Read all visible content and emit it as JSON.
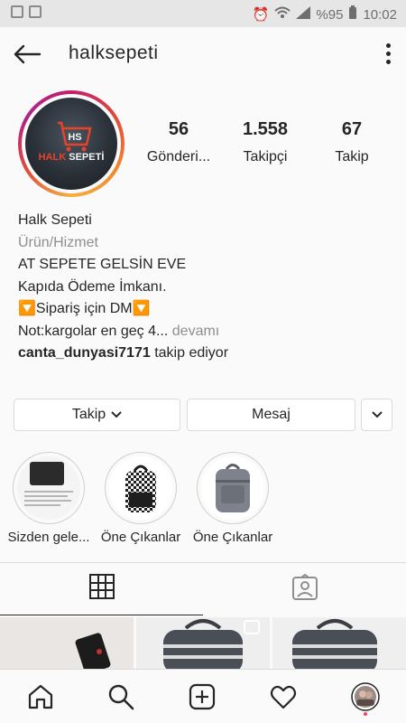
{
  "status_bar": {
    "battery_percent": "%95",
    "time": "10:02"
  },
  "header": {
    "username": "halksepeti"
  },
  "avatar": {
    "logo_word_1": "HALK",
    "logo_word_2": "SEPETİ",
    "logo_mark": "HS"
  },
  "stats": [
    {
      "value": "56",
      "label": "Gönderi..."
    },
    {
      "value": "1.558",
      "label": "Takipçi"
    },
    {
      "value": "67",
      "label": "Takip"
    }
  ],
  "bio": {
    "name": "Halk Sepeti",
    "category": "Ürün/Hizmet",
    "line1": "AT SEPETE GELSİN EVE",
    "line2": "Kapıda Ödeme İmkanı.",
    "line3": "🔽Sipariş için DM🔽",
    "line4": "Not:kargolar en geç 4...",
    "more": "devamı",
    "followed_by_user": "canta_dunyasi7171",
    "followed_by_suffix": "takip ediyor"
  },
  "buttons": {
    "follow": "Takip",
    "message": "Mesaj"
  },
  "highlights": [
    {
      "label": "Sizden gele..."
    },
    {
      "label": "Öne Çıkanlar"
    },
    {
      "label": "Öne Çıkanlar"
    }
  ],
  "colors": {
    "text": "#262626",
    "muted": "#8e8e8e",
    "border": "#dbdbdb",
    "status_bar": "#e6e6e6",
    "background": "#fafafa"
  }
}
